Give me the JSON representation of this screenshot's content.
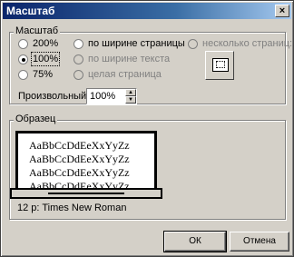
{
  "window": {
    "title": "Масштаб",
    "close_glyph": "×"
  },
  "zoom_group": {
    "legend": "Масштаб",
    "options": [
      {
        "label": "200%",
        "checked": false,
        "enabled": true
      },
      {
        "label": "100%",
        "checked": true,
        "enabled": true
      },
      {
        "label": "75%",
        "checked": false,
        "enabled": true
      },
      {
        "label": "по ширине страницы",
        "checked": false,
        "enabled": true
      },
      {
        "label": "по ширине текста",
        "checked": false,
        "enabled": false
      },
      {
        "label": "целая страница",
        "checked": false,
        "enabled": false
      },
      {
        "label": "несколько страниц:",
        "checked": false,
        "enabled": false
      }
    ],
    "custom_label": "Произвольный:",
    "custom_value": "100%"
  },
  "preview_group": {
    "legend": "Образец",
    "sample_lines": [
      "AaBbCcDdEeXxYyZz",
      "AaBbCcDdEeXxYyZz",
      "AaBbCcDdEeXxYyZz",
      "AaBbCcDdEeXxYyZz"
    ],
    "font_info": "12 p: Times New Roman"
  },
  "buttons": {
    "ok": "ОК",
    "cancel": "Отмена"
  },
  "colors": {
    "face": "#d4d0c8",
    "title_start": "#0a246a",
    "title_end": "#a6caf0"
  }
}
